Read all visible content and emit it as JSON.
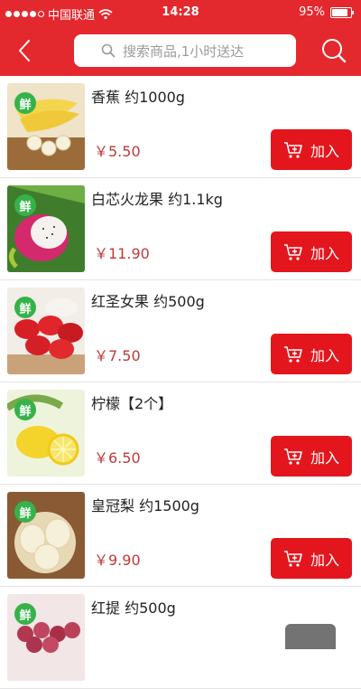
{
  "status_bar": {
    "carrier": "中国联通",
    "time": "14:28",
    "battery": "95%",
    "battery_level": 0.95
  },
  "header": {
    "search_placeholder": "搜索商品,1小时送达"
  },
  "colors": {
    "brand": "#e4292e",
    "button": "#e4161d",
    "price": "#c0393b",
    "fresh_badge": "#36b24a"
  },
  "products": [
    {
      "name": "香蕉 约1000g",
      "price": "￥5.50",
      "badge": "鲜",
      "button": "加入"
    },
    {
      "name": "白芯火龙果 约1.1kg",
      "price": "￥11.90",
      "badge": "鲜",
      "button": "加入"
    },
    {
      "name": "红圣女果 约500g",
      "price": "￥7.50",
      "badge": "鲜",
      "button": "加入"
    },
    {
      "name": "柠檬【2个】",
      "price": "￥6.50",
      "badge": "鲜",
      "button": "加入"
    },
    {
      "name": "皇冠梨 约1500g",
      "price": "￥9.90",
      "badge": "鲜",
      "button": "加入"
    },
    {
      "name": "红提 约500g",
      "price": "",
      "badge": "鲜",
      "button": ""
    }
  ],
  "icons": {
    "back": "chevron-left-icon",
    "search": "search-icon",
    "cart": "cart-icon"
  }
}
